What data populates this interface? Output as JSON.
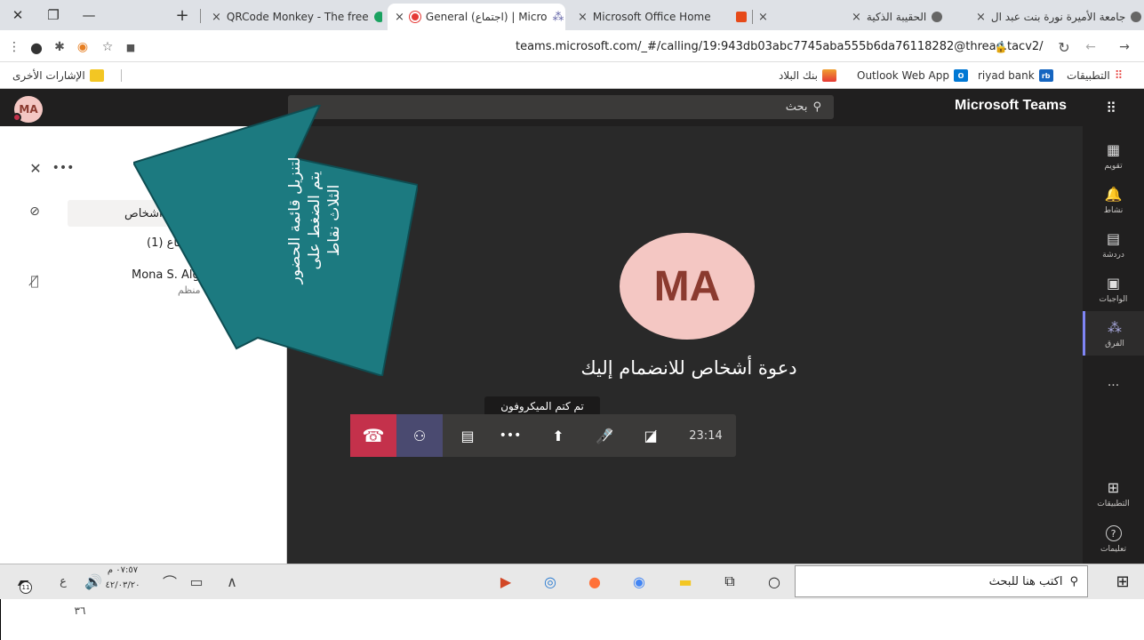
{
  "browser": {
    "tabs": [
      {
        "label": "جامعة الأميرة نورة بنت عبد ال",
        "close": "×"
      },
      {
        "label": "الحقيبة الذكية",
        "close": "×"
      },
      {
        "label": "",
        "close": "×"
      },
      {
        "label": "Microsoft Office Home",
        "close": "×"
      },
      {
        "label": "General (اجتماع) | Micro",
        "close": "×"
      },
      {
        "label": "QRCode Monkey - The free",
        "close": "×"
      }
    ],
    "new_tab": "+",
    "url": "teams.microsoft.com/_#/calling/19:943db03abc7745aba555b6da76118282@thread.tacv2/",
    "bookmarks": {
      "apps": "التطبيقات",
      "riyad": "riyad bank",
      "riyad_icon": "rb",
      "outlook": "Outlook Web App",
      "outlook_icon": "O",
      "albilad": "بنك البلاد",
      "other": "الإشارات الأخرى"
    }
  },
  "teams": {
    "title": "Microsoft Teams",
    "search_placeholder": "بحث",
    "avatar_initials": "MA",
    "rail": [
      {
        "label": "تقويم",
        "icon": "calendar-icon",
        "glyph": "▦"
      },
      {
        "label": "نشاط",
        "icon": "bell-icon",
        "glyph": "🔔"
      },
      {
        "label": "دردشة",
        "icon": "chat-icon",
        "glyph": "▤"
      },
      {
        "label": "الواجبات",
        "icon": "assignments-icon",
        "glyph": "▣"
      },
      {
        "label": "الفرق",
        "icon": "teams-icon",
        "glyph": "⁂"
      },
      {
        "label": "...",
        "icon": "more-icon",
        "glyph": ""
      },
      {
        "label": "التطبيقات",
        "icon": "apps-icon",
        "glyph": "⊞"
      },
      {
        "label": "تعليمات",
        "icon": "help-icon",
        "glyph": "?"
      }
    ],
    "panel": {
      "invite_label": "أشخاص",
      "meeting_label": "في الاجتماع (1)",
      "participant_name": "Mona S. Alga",
      "participant_role": "منظم"
    },
    "stage": {
      "big_avatar": "MA",
      "invite_text": "دعوة أشخاص للانضمام إليك",
      "tooltip": "تم كتم الميكروفون",
      "timer": "23:14"
    },
    "annotation": "لتنزيل قائمة الحضور يتم الضغط على الثلاث نقاط"
  },
  "taskbar": {
    "search": "اكتب هنا للبحث",
    "time": "٠٧:٥٧ م",
    "date": "٤٢/٠٣/٢٠",
    "lang": "ع",
    "badge": "11"
  },
  "page_number": "٣٦"
}
